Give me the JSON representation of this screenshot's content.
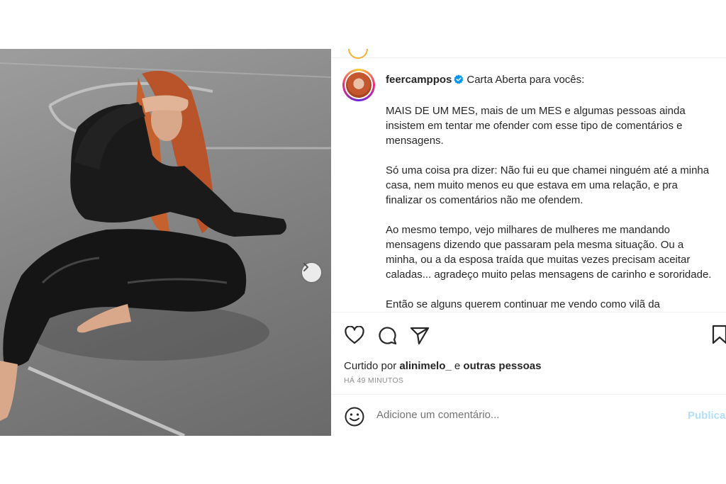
{
  "post": {
    "username": "feercamppos",
    "verified_icon": "verified-badge-icon",
    "caption_lead": "Carta Aberta para vocês:",
    "caption_paragraphs": [
      "MAIS DE UM MES, mais de um MES e algumas pessoas ainda insistem em tentar me ofender com esse tipo de comentários e mensagens.",
      "Só uma coisa pra dizer: Não fui eu que chamei ninguém até a minha casa, nem muito menos eu que estava em uma relação, e pra finalizar os comentários não me ofendem.",
      "Ao mesmo tempo, vejo milhares de mulheres me mandando mensagens dizendo que passaram pela mesma situação. Ou a minha, ou a da esposa traída que muitas vezes precisam aceitar caladas... agradeço muito pelas mensagens de carinho e sororidade.",
      "Então se alguns querem continuar me vendo como vilã da"
    ],
    "likes": {
      "prefix": "Curtido por",
      "user": "alinimelo_",
      "connector": "e",
      "others": "outras pessoas"
    },
    "timestamp": "HÁ 49 MINUTOS"
  },
  "comment": {
    "placeholder": "Adicione um comentário...",
    "publish_label": "Publicar"
  },
  "carousel": {
    "slides": 2,
    "active_index": 0
  },
  "colors": {
    "text": "#262626",
    "muted": "#8e8e8e",
    "verified": "#0095f6",
    "publish_disabled": "#b2dffc"
  }
}
